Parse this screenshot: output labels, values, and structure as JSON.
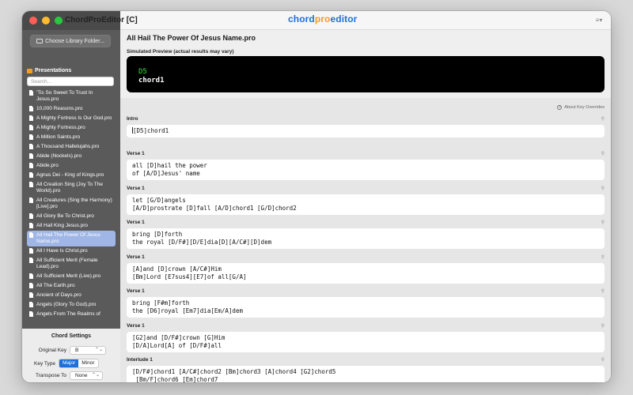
{
  "window": {
    "app_title": "ChordProEditor [C]"
  },
  "brand": {
    "part1": "chord",
    "part2": "pro",
    "part3": "editor"
  },
  "sidebar": {
    "library_button": "Choose Library Folder...",
    "presentations_header": "Presentations",
    "search_placeholder": "Search...",
    "files": [
      "'Tis So Sweet To Trust In Jesus.pro",
      "10,000 Reasons.pro",
      "A Mighty Fortress Is Our God.pro",
      "A Mighty Fortress.pro",
      "A Million Saints.pro",
      "A Thousand Hallelujahs.pro",
      "Abide (Nockels).pro",
      "Abide.pro",
      "Agnus Dei - King of Kings.pro",
      "All Creation Sing (Joy To The World).pro",
      "All Creatures (Sing the Harmony) [Live].pro",
      "All Glory Be To Christ.pro",
      "All Hail King Jesus.pro",
      "All Hail The Power Of Jesus Name.pro",
      "All I Have Is Christ.pro",
      "All Sufficient Merit (Female Lead).pro",
      "All Sufficient Merit (Live).pro",
      "All The Earth.pro",
      "Ancient of Days.pro",
      "Angels (Glory To God).pro",
      "Angels From The Realms of"
    ],
    "selected_index": 13,
    "chord_settings": {
      "title": "Chord Settings",
      "original_key_label": "Original Key",
      "original_key_value": "B",
      "key_type_label": "Key Type",
      "key_type_major": "Major",
      "key_type_minor": "Minor",
      "transpose_label": "Transpose To",
      "transpose_value": "None"
    }
  },
  "main": {
    "doc_title": "All Hail The Power Of Jesus Name.pro",
    "preview_label": "Simulated Preview (actual results may vary)",
    "preview_chord": "D5",
    "preview_lyric": "chord1",
    "about_key": "About Key Overrides",
    "sections": [
      {
        "label": "Intro",
        "text": "[D5]chord1"
      },
      {
        "label": "Verse 1",
        "text": "all [D]hail the power\nof [A/D]Jesus' name"
      },
      {
        "label": "Verse 1",
        "text": "let [G/D]angels\n[A/D]prostrate [D]fall [A/D]chord1 [G/D]chord2"
      },
      {
        "label": "Verse 1",
        "text": "bring [D]forth\nthe royal [D/F#][D/E]dia[D][A/C#][D]dem"
      },
      {
        "label": "Verse 1",
        "text": "[A]and [D]crown [A/C#]Him\n[Bm]Lord [E7sus4][E7]of all[G/A]"
      },
      {
        "label": "Verse 1",
        "text": "bring [F#m]forth\nthe [D6]royal [Em7]dia[Em/A]dem"
      },
      {
        "label": "Verse 1",
        "text": "[G2]and [D/F#]crown [G]Him\n[D/A]Lord[A] of [D/F#]all"
      },
      {
        "label": "Interlude 1",
        "text": "[D/F#]chord1 [A/C#]chord2 [Bm]chord3 [A]chord4 [G2]chord5\n [Bm/F]chord6 [Em]chord7"
      }
    ]
  }
}
